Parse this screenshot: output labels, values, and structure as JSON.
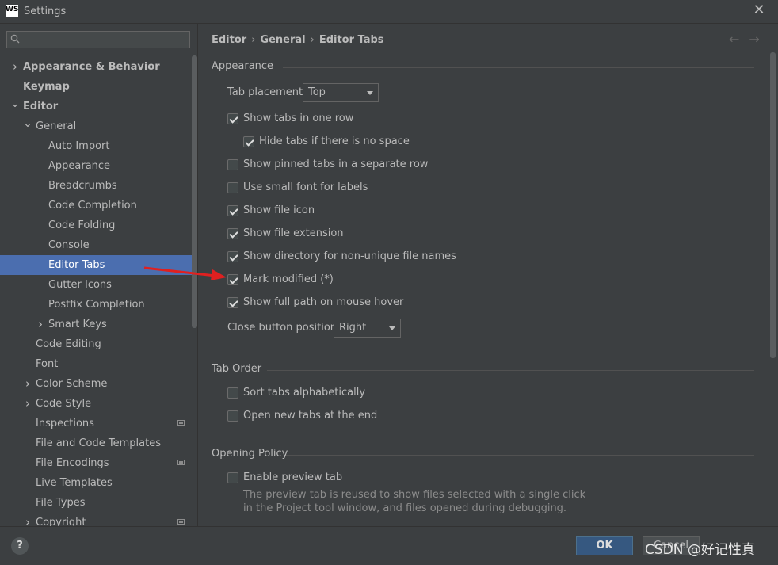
{
  "window": {
    "title": "Settings",
    "app_icon": "WS"
  },
  "search": {
    "placeholder": ""
  },
  "sidebar": {
    "items": [
      {
        "label": "Appearance & Behavior",
        "level": 0,
        "chevron": "right",
        "bold": true
      },
      {
        "label": "Keymap",
        "level": 0,
        "chevron": "",
        "bold": true
      },
      {
        "label": "Editor",
        "level": 0,
        "chevron": "down",
        "bold": true
      },
      {
        "label": "General",
        "level": 1,
        "chevron": "down"
      },
      {
        "label": "Auto Import",
        "level": 2,
        "chevron": ""
      },
      {
        "label": "Appearance",
        "level": 2,
        "chevron": ""
      },
      {
        "label": "Breadcrumbs",
        "level": 2,
        "chevron": ""
      },
      {
        "label": "Code Completion",
        "level": 2,
        "chevron": ""
      },
      {
        "label": "Code Folding",
        "level": 2,
        "chevron": ""
      },
      {
        "label": "Console",
        "level": 2,
        "chevron": ""
      },
      {
        "label": "Editor Tabs",
        "level": 2,
        "chevron": "",
        "selected": true
      },
      {
        "label": "Gutter Icons",
        "level": 2,
        "chevron": ""
      },
      {
        "label": "Postfix Completion",
        "level": 2,
        "chevron": ""
      },
      {
        "label": "Smart Keys",
        "level": 2,
        "chevron": "right"
      },
      {
        "label": "Code Editing",
        "level": 1,
        "chevron": ""
      },
      {
        "label": "Font",
        "level": 1,
        "chevron": ""
      },
      {
        "label": "Color Scheme",
        "level": 1,
        "chevron": "right"
      },
      {
        "label": "Code Style",
        "level": 1,
        "chevron": "right"
      },
      {
        "label": "Inspections",
        "level": 1,
        "chevron": "",
        "project_icon": true
      },
      {
        "label": "File and Code Templates",
        "level": 1,
        "chevron": ""
      },
      {
        "label": "File Encodings",
        "level": 1,
        "chevron": "",
        "project_icon": true
      },
      {
        "label": "Live Templates",
        "level": 1,
        "chevron": ""
      },
      {
        "label": "File Types",
        "level": 1,
        "chevron": ""
      },
      {
        "label": "Copyright",
        "level": 1,
        "chevron": "right",
        "project_icon": true
      }
    ]
  },
  "breadcrumb": {
    "parts": [
      "Editor",
      "General",
      "Editor Tabs"
    ],
    "sep": "›"
  },
  "nav": {
    "back": "←",
    "forward": "→"
  },
  "appearance": {
    "title": "Appearance",
    "tab_placement_label": "Tab placement:",
    "tab_placement_value": "Top",
    "options": [
      {
        "label": "Show tabs in one row",
        "checked": true,
        "indent": 0
      },
      {
        "label": "Hide tabs if there is no space",
        "checked": true,
        "indent": 1
      },
      {
        "label": "Show pinned tabs in a separate row",
        "checked": false,
        "indent": 0
      },
      {
        "label": "Use small font for labels",
        "checked": false,
        "indent": 0
      },
      {
        "label": "Show file icon",
        "checked": true,
        "indent": 0
      },
      {
        "label": "Show file extension",
        "checked": true,
        "indent": 0
      },
      {
        "label": "Show directory for non-unique file names",
        "checked": true,
        "indent": 0
      },
      {
        "label": "Mark modified (*)",
        "checked": true,
        "indent": 0
      },
      {
        "label": "Show full path on mouse hover",
        "checked": true,
        "indent": 0
      }
    ],
    "close_button_label": "Close button position:",
    "close_button_value": "Right"
  },
  "tab_order": {
    "title": "Tab Order",
    "options": [
      {
        "label": "Sort tabs alphabetically",
        "checked": false
      },
      {
        "label": "Open new tabs at the end",
        "checked": false
      }
    ]
  },
  "opening_policy": {
    "title": "Opening Policy",
    "options": [
      {
        "label": "Enable preview tab",
        "checked": false
      }
    ],
    "description_line1": "The preview tab is reused to show files selected with a single click",
    "description_line2": "in the Project tool window, and files opened during debugging."
  },
  "buttons": {
    "help": "?",
    "ok": "OK",
    "cancel": "Cancel"
  },
  "watermark": "CSDN @好记性真",
  "colors": {
    "selected": "#4b6eaf",
    "background": "#3c3f41",
    "annotation_arrow": "#e02020"
  }
}
